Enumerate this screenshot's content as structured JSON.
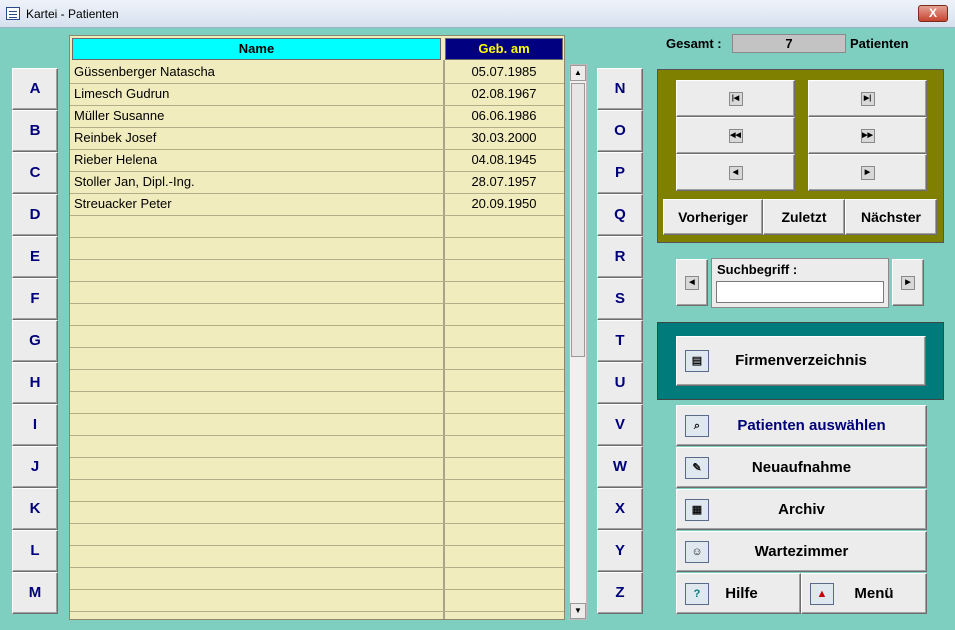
{
  "window": {
    "title": "Kartei - Patienten",
    "close_label": "X"
  },
  "letters_left": [
    "A",
    "B",
    "C",
    "D",
    "E",
    "F",
    "G",
    "H",
    "I",
    "J",
    "K",
    "L",
    "M"
  ],
  "letters_right": [
    "N",
    "O",
    "P",
    "Q",
    "R",
    "S",
    "T",
    "U",
    "V",
    "W",
    "X",
    "Y",
    "Z"
  ],
  "table": {
    "columns": [
      "Name",
      "Geb. am"
    ],
    "rows": [
      {
        "name": "Güssenberger Natascha",
        "date": "05.07.1985"
      },
      {
        "name": "Limesch Gudrun",
        "date": "02.08.1967"
      },
      {
        "name": "Müller Susanne",
        "date": "06.06.1986"
      },
      {
        "name": "Reinbek Josef",
        "date": "30.03.2000"
      },
      {
        "name": "Rieber Helena",
        "date": "04.08.1945"
      },
      {
        "name": "Stoller Jan, Dipl.-Ing.",
        "date": "28.07.1957"
      },
      {
        "name": "Streuacker Peter",
        "date": "20.09.1950"
      },
      {
        "name": "",
        "date": ""
      },
      {
        "name": "",
        "date": ""
      },
      {
        "name": "",
        "date": ""
      },
      {
        "name": "",
        "date": ""
      },
      {
        "name": "",
        "date": ""
      },
      {
        "name": "",
        "date": ""
      },
      {
        "name": "",
        "date": ""
      },
      {
        "name": "",
        "date": ""
      },
      {
        "name": "",
        "date": ""
      },
      {
        "name": "",
        "date": ""
      },
      {
        "name": "",
        "date": ""
      },
      {
        "name": "",
        "date": ""
      },
      {
        "name": "",
        "date": ""
      },
      {
        "name": "",
        "date": ""
      },
      {
        "name": "",
        "date": ""
      },
      {
        "name": "",
        "date": ""
      },
      {
        "name": "",
        "date": ""
      },
      {
        "name": "",
        "date": ""
      }
    ]
  },
  "count": {
    "label": "Gesamt :",
    "value": "7",
    "suffix": "Patienten"
  },
  "navigation": {
    "prev_label": "Vorheriger",
    "last_label": "Zuletzt",
    "next_label": "Nächster"
  },
  "search": {
    "label": "Suchbegriff :",
    "value": ""
  },
  "firmen": {
    "label": "Firmenverzeichnis"
  },
  "actions": {
    "select_label": "Patienten auswählen",
    "new_label": "Neuaufnahme",
    "archive_label": "Archiv",
    "waiting_label": "Wartezimmer",
    "help_label": "Hilfe",
    "menu_label": "Menü"
  },
  "colors": {
    "background": "#7ecfc0",
    "name_header": "#00ffff",
    "date_header": "#000080",
    "date_header_text": "#ffff00",
    "grid_background": "#f1ecbd",
    "nav_panel": "#7f7f00",
    "firmen_panel": "#007b7b",
    "accent_text": "#00007a"
  }
}
